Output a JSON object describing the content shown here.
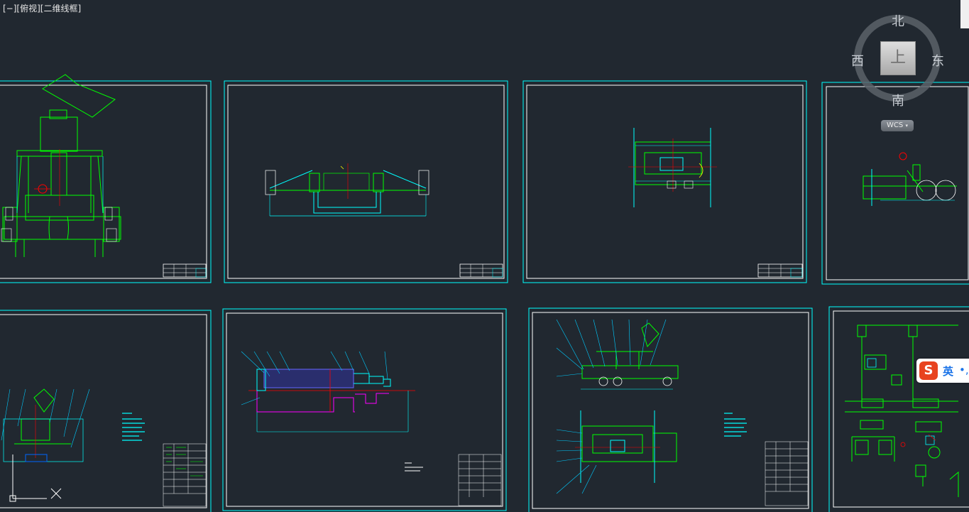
{
  "viewport": {
    "label": "[−][俯视][二维线框]"
  },
  "viewcube": {
    "north": "北",
    "south": "南",
    "west": "西",
    "east": "东",
    "face": "上",
    "wcs": "WCS"
  },
  "ime": {
    "logo": "S",
    "mode": "英",
    "dot": "•,"
  },
  "colors": {
    "background": "#212830",
    "sheet_border": "#00ffff",
    "sheet_inner": "#ffffff",
    "geometry": "#00ff00",
    "leader": "#00ccff",
    "hatch": "#6666ff",
    "center": "#ff0000",
    "magenta": "#ff00ff",
    "yellow": "#ffff00"
  },
  "icons": {
    "ucs": "ucs-axis-icon",
    "viewcube": "viewcube-icon"
  }
}
